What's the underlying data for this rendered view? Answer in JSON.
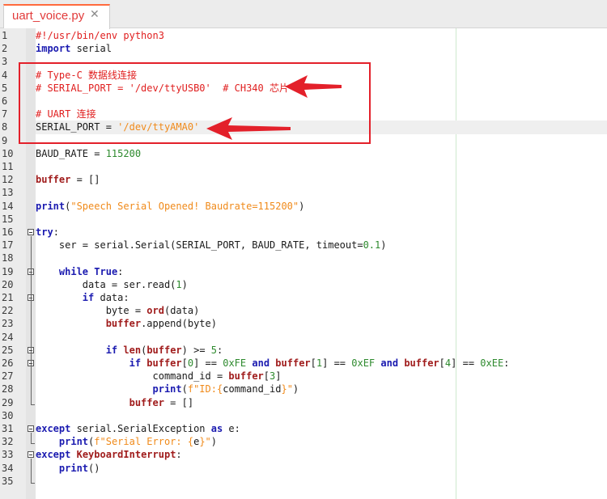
{
  "tab": {
    "filename": "uart_voice.py",
    "close_glyph": "✕"
  },
  "lines": [
    {
      "n": "1",
      "tokens": [
        {
          "t": "#!/usr/bin/env python3",
          "c": "comment"
        }
      ]
    },
    {
      "n": "2",
      "tokens": [
        {
          "t": "import",
          "c": "kw"
        },
        {
          "t": " serial",
          "c": "default"
        }
      ]
    },
    {
      "n": "3",
      "tokens": []
    },
    {
      "n": "4",
      "tokens": [
        {
          "t": "# Type-C 数据线连接",
          "c": "comment"
        }
      ]
    },
    {
      "n": "5",
      "tokens": [
        {
          "t": "# SERIAL_PORT = '/dev/ttyUSB0'  # CH340 芯片",
          "c": "comment"
        }
      ]
    },
    {
      "n": "6",
      "tokens": []
    },
    {
      "n": "7",
      "tokens": [
        {
          "t": "# UART 连接",
          "c": "comment"
        }
      ]
    },
    {
      "n": "8",
      "tokens": [
        {
          "t": "SERIAL_PORT = ",
          "c": "default"
        },
        {
          "t": "'/dev/ttyAMA0'",
          "c": "str"
        }
      ]
    },
    {
      "n": "9",
      "tokens": []
    },
    {
      "n": "10",
      "tokens": [
        {
          "t": "BAUD_RATE = ",
          "c": "default"
        },
        {
          "t": "115200",
          "c": "num"
        }
      ]
    },
    {
      "n": "11",
      "tokens": []
    },
    {
      "n": "12",
      "tokens": [
        {
          "t": "buffer",
          "c": "builtin"
        },
        {
          "t": " = []",
          "c": "default"
        }
      ]
    },
    {
      "n": "13",
      "tokens": []
    },
    {
      "n": "14",
      "tokens": [
        {
          "t": "print",
          "c": "kw"
        },
        {
          "t": "(",
          "c": "default"
        },
        {
          "t": "\"Speech Serial Opened! Baudrate=115200\"",
          "c": "str"
        },
        {
          "t": ")",
          "c": "default"
        }
      ]
    },
    {
      "n": "15",
      "tokens": []
    },
    {
      "n": "16",
      "tokens": [
        {
          "t": "try",
          "c": "kw"
        },
        {
          "t": ":",
          "c": "default"
        }
      ]
    },
    {
      "n": "17",
      "tokens": [
        {
          "t": "    ser = serial.Serial(SERIAL_PORT, BAUD_RATE, timeout=",
          "c": "default"
        },
        {
          "t": "0.1",
          "c": "num"
        },
        {
          "t": ")",
          "c": "default"
        }
      ]
    },
    {
      "n": "18",
      "tokens": []
    },
    {
      "n": "19",
      "tokens": [
        {
          "t": "    ",
          "c": "default"
        },
        {
          "t": "while",
          "c": "kw"
        },
        {
          "t": " ",
          "c": "default"
        },
        {
          "t": "True",
          "c": "kw"
        },
        {
          "t": ":",
          "c": "default"
        }
      ]
    },
    {
      "n": "20",
      "tokens": [
        {
          "t": "        data = ser.read(",
          "c": "default"
        },
        {
          "t": "1",
          "c": "num"
        },
        {
          "t": ")",
          "c": "default"
        }
      ]
    },
    {
      "n": "21",
      "tokens": [
        {
          "t": "        ",
          "c": "default"
        },
        {
          "t": "if",
          "c": "kw"
        },
        {
          "t": " data:",
          "c": "default"
        }
      ]
    },
    {
      "n": "22",
      "tokens": [
        {
          "t": "            byte = ",
          "c": "default"
        },
        {
          "t": "ord",
          "c": "builtin"
        },
        {
          "t": "(data)",
          "c": "default"
        }
      ]
    },
    {
      "n": "23",
      "tokens": [
        {
          "t": "            ",
          "c": "default"
        },
        {
          "t": "buffer",
          "c": "builtin"
        },
        {
          "t": ".append(byte)",
          "c": "default"
        }
      ]
    },
    {
      "n": "24",
      "tokens": []
    },
    {
      "n": "25",
      "tokens": [
        {
          "t": "            ",
          "c": "default"
        },
        {
          "t": "if",
          "c": "kw"
        },
        {
          "t": " ",
          "c": "default"
        },
        {
          "t": "len",
          "c": "builtin"
        },
        {
          "t": "(",
          "c": "default"
        },
        {
          "t": "buffer",
          "c": "builtin"
        },
        {
          "t": ") >= ",
          "c": "default"
        },
        {
          "t": "5",
          "c": "num"
        },
        {
          "t": ":",
          "c": "default"
        }
      ]
    },
    {
      "n": "26",
      "tokens": [
        {
          "t": "                ",
          "c": "default"
        },
        {
          "t": "if",
          "c": "kw"
        },
        {
          "t": " ",
          "c": "default"
        },
        {
          "t": "buffer",
          "c": "builtin"
        },
        {
          "t": "[",
          "c": "default"
        },
        {
          "t": "0",
          "c": "num"
        },
        {
          "t": "] == ",
          "c": "default"
        },
        {
          "t": "0xFE",
          "c": "num"
        },
        {
          "t": " ",
          "c": "default"
        },
        {
          "t": "and",
          "c": "kw"
        },
        {
          "t": " ",
          "c": "default"
        },
        {
          "t": "buffer",
          "c": "builtin"
        },
        {
          "t": "[",
          "c": "default"
        },
        {
          "t": "1",
          "c": "num"
        },
        {
          "t": "] == ",
          "c": "default"
        },
        {
          "t": "0xEF",
          "c": "num"
        },
        {
          "t": " ",
          "c": "default"
        },
        {
          "t": "and",
          "c": "kw"
        },
        {
          "t": " ",
          "c": "default"
        },
        {
          "t": "buffer",
          "c": "builtin"
        },
        {
          "t": "[",
          "c": "default"
        },
        {
          "t": "4",
          "c": "num"
        },
        {
          "t": "] == ",
          "c": "default"
        },
        {
          "t": "0xEE",
          "c": "num"
        },
        {
          "t": ":",
          "c": "default"
        }
      ]
    },
    {
      "n": "27",
      "tokens": [
        {
          "t": "                    command_id = ",
          "c": "default"
        },
        {
          "t": "buffer",
          "c": "builtin"
        },
        {
          "t": "[",
          "c": "default"
        },
        {
          "t": "3",
          "c": "num"
        },
        {
          "t": "]",
          "c": "default"
        }
      ]
    },
    {
      "n": "28",
      "tokens": [
        {
          "t": "                    ",
          "c": "default"
        },
        {
          "t": "print",
          "c": "kw"
        },
        {
          "t": "(",
          "c": "default"
        },
        {
          "t": "f\"ID:{",
          "c": "str"
        },
        {
          "t": "command_id",
          "c": "default"
        },
        {
          "t": "}\"",
          "c": "str"
        },
        {
          "t": ")",
          "c": "default"
        }
      ]
    },
    {
      "n": "29",
      "tokens": [
        {
          "t": "                ",
          "c": "default"
        },
        {
          "t": "buffer",
          "c": "builtin"
        },
        {
          "t": " = []",
          "c": "default"
        }
      ]
    },
    {
      "n": "30",
      "tokens": []
    },
    {
      "n": "31",
      "tokens": [
        {
          "t": "except",
          "c": "kw"
        },
        {
          "t": " serial.SerialException ",
          "c": "default"
        },
        {
          "t": "as",
          "c": "kw"
        },
        {
          "t": " e:",
          "c": "default"
        }
      ]
    },
    {
      "n": "32",
      "tokens": [
        {
          "t": "    ",
          "c": "default"
        },
        {
          "t": "print",
          "c": "kw"
        },
        {
          "t": "(",
          "c": "default"
        },
        {
          "t": "f\"Serial Error: {",
          "c": "str"
        },
        {
          "t": "e",
          "c": "default"
        },
        {
          "t": "}\"",
          "c": "str"
        },
        {
          "t": ")",
          "c": "default"
        }
      ]
    },
    {
      "n": "33",
      "tokens": [
        {
          "t": "except",
          "c": "kw"
        },
        {
          "t": " ",
          "c": "default"
        },
        {
          "t": "KeyboardInterrupt",
          "c": "builtin"
        },
        {
          "t": ":",
          "c": "default"
        }
      ]
    },
    {
      "n": "34",
      "tokens": [
        {
          "t": "    ",
          "c": "default"
        },
        {
          "t": "print",
          "c": "kw"
        },
        {
          "t": "()",
          "c": "default"
        }
      ]
    },
    {
      "n": "35",
      "tokens": []
    }
  ],
  "current_line": "8",
  "fold_markers": [
    "16",
    "19",
    "21",
    "25",
    "26",
    "31",
    "33"
  ],
  "colors": {
    "comment": "#e02020",
    "keyword": "#1b1bb0",
    "builtin": "#a01c1c",
    "string": "#f08a1a",
    "number": "#2e8a2e",
    "annotation": "#e3202a"
  }
}
